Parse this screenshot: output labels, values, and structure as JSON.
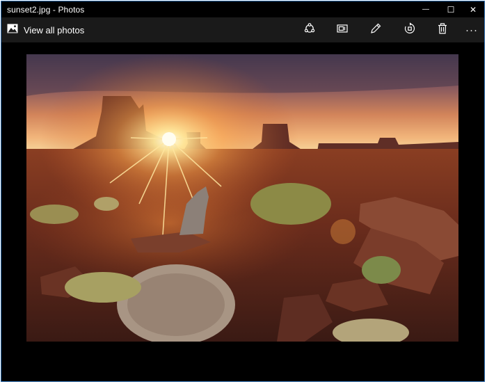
{
  "window": {
    "title": "sunset2.jpg - Photos",
    "minimize_glyph": "—",
    "maximize_glyph": "☐",
    "close_glyph": "✕"
  },
  "toolbar": {
    "view_all_label": "View all photos",
    "view_all_icon": "gallery-icon",
    "more_label": "···",
    "buttons": [
      {
        "name": "share-button",
        "icon": "share-icon"
      },
      {
        "name": "slideshow-button",
        "icon": "slideshow-icon"
      },
      {
        "name": "edit-button",
        "icon": "pencil-icon"
      },
      {
        "name": "rotate-button",
        "icon": "rotate-icon"
      },
      {
        "name": "delete-button",
        "icon": "trash-icon"
      }
    ]
  },
  "colors": {
    "titlebar_bg": "#000000",
    "toolbar_bg": "#1a1a1a",
    "window_border": "#2b6cb0",
    "canvas_bg": "#000000"
  }
}
